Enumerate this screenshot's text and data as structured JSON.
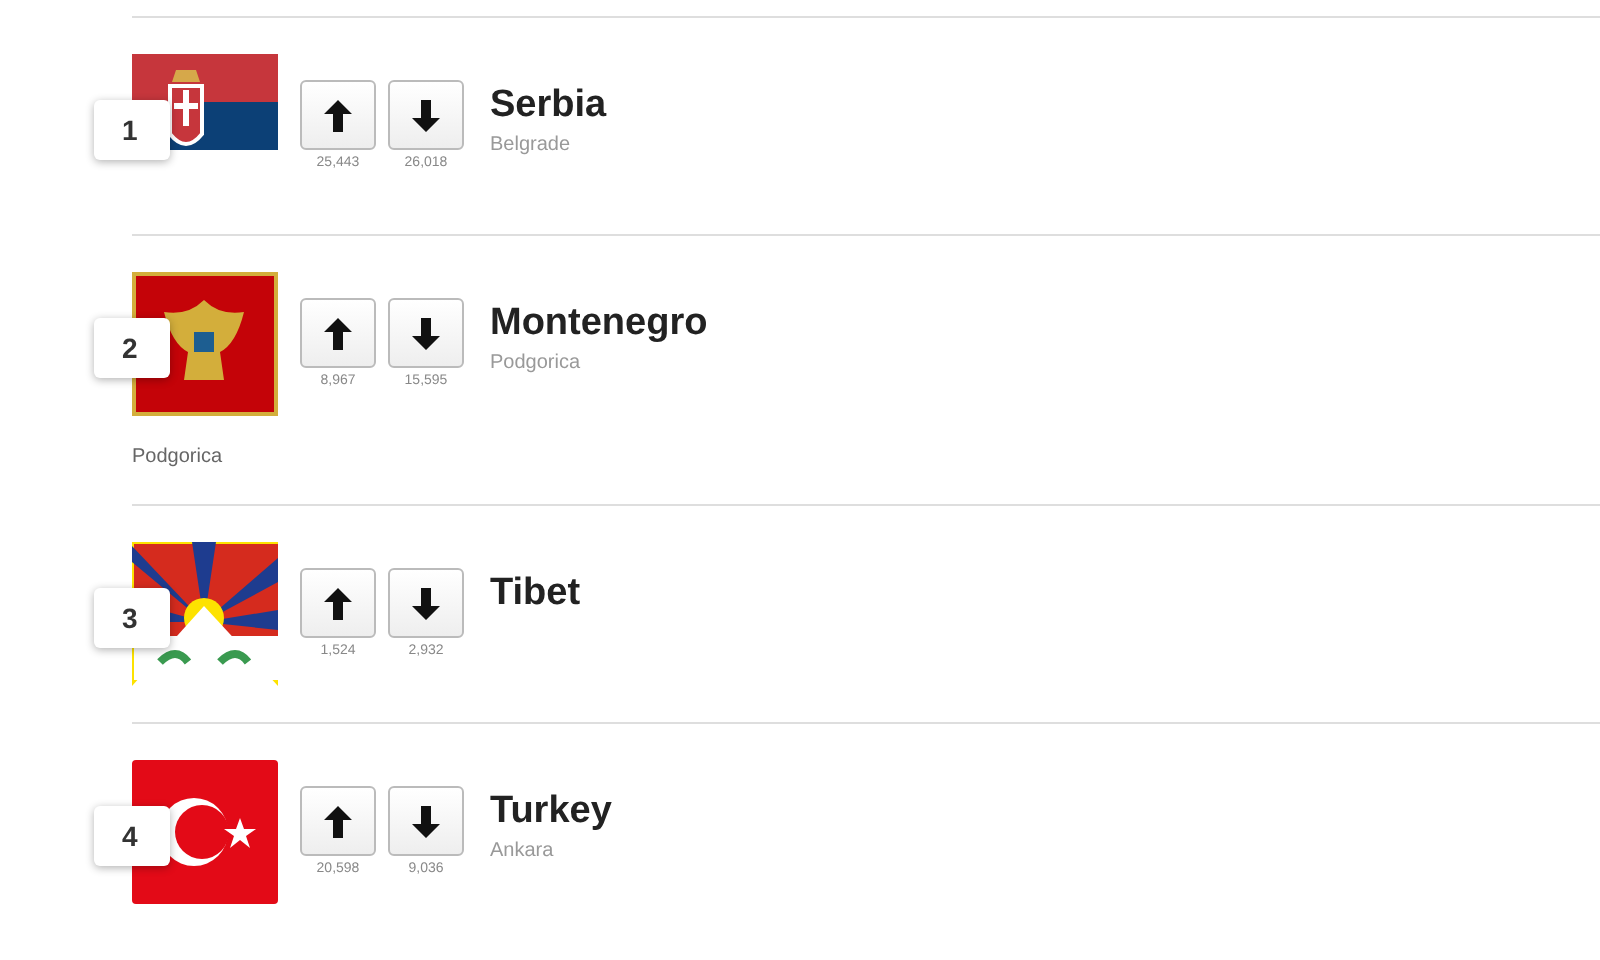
{
  "items": [
    {
      "rank": "1",
      "kind": "serbia",
      "up_count": "25,443",
      "down_count": "26,018",
      "name": "Serbia",
      "capital": "Belgrade"
    },
    {
      "rank": "2",
      "kind": "montenegro",
      "up_count": "8,967",
      "down_count": "15,595",
      "name": "Montenegro",
      "capital": "Podgorica",
      "note": "Podgorica"
    },
    {
      "rank": "3",
      "kind": "tibet",
      "up_count": "1,524",
      "down_count": "2,932",
      "name": "Tibet"
    },
    {
      "rank": "4",
      "kind": "turkey",
      "up_count": "20,598",
      "down_count": "9,036",
      "name": "Turkey",
      "capital": "Ankara"
    }
  ]
}
